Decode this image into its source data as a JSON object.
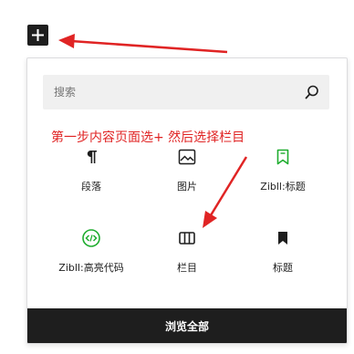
{
  "inserter": {
    "search_placeholder": "搜索",
    "annotation": "第一步内容页面选+ 然后选择栏目",
    "blocks": [
      {
        "label": "段落",
        "icon": "paragraph-icon"
      },
      {
        "label": "图片",
        "icon": "image-icon"
      },
      {
        "label": "Zibll:标题",
        "icon": "bookmark-outline-icon"
      },
      {
        "label": "Zibll:高亮代码",
        "icon": "code-icon"
      },
      {
        "label": "栏目",
        "icon": "columns-icon"
      },
      {
        "label": "标题",
        "icon": "bookmark-icon"
      }
    ],
    "browse_all": "浏览全部"
  },
  "colors": {
    "annotation": "#e02424",
    "accent_green": "#1fad2f",
    "dark": "#1e1e1e"
  }
}
